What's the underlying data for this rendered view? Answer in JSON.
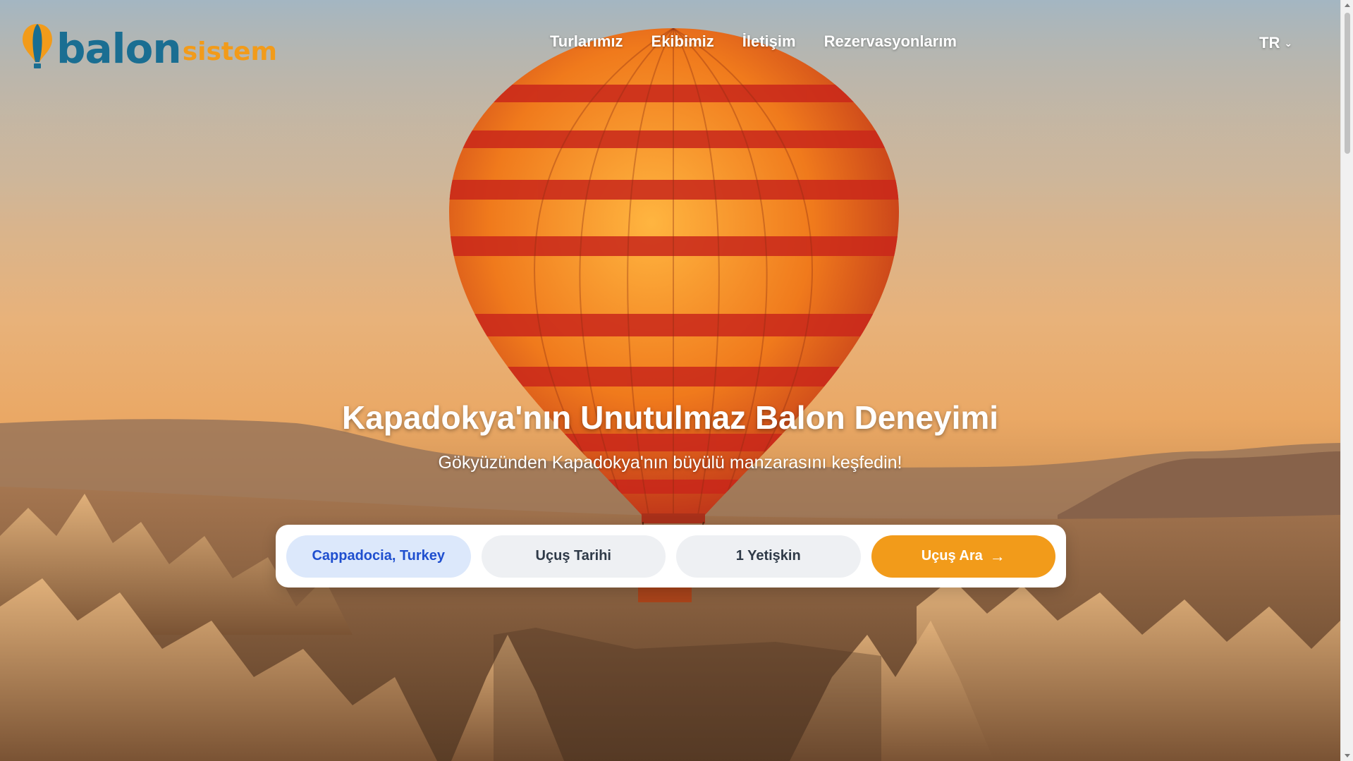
{
  "brand": {
    "main": "balon",
    "sub": "sistem"
  },
  "nav": {
    "items": [
      {
        "label": "Turlarımız"
      },
      {
        "label": "Ekibimiz"
      },
      {
        "label": "İletişim"
      },
      {
        "label": "Rezervasyonlarım"
      }
    ]
  },
  "language": {
    "current": "TR",
    "chevron": "⌄"
  },
  "hero": {
    "title": "Kapadokya'nın Unutulmaz Balon Deneyimi",
    "subtitle": "Gökyüzünden Kapadokya'nın büyülü manzarasını keşfedin!"
  },
  "search": {
    "location": "Cappadocia, Turkey",
    "date": "Uçuş Tarihi",
    "guests": "1 Yetişkin",
    "submit": "Uçuş Ara",
    "submit_arrow": "→"
  },
  "colors": {
    "brand_blue": "#1a6e92",
    "brand_orange": "#f29b1a",
    "location_bg": "#dce8fb",
    "location_text": "#1f4fcf"
  }
}
